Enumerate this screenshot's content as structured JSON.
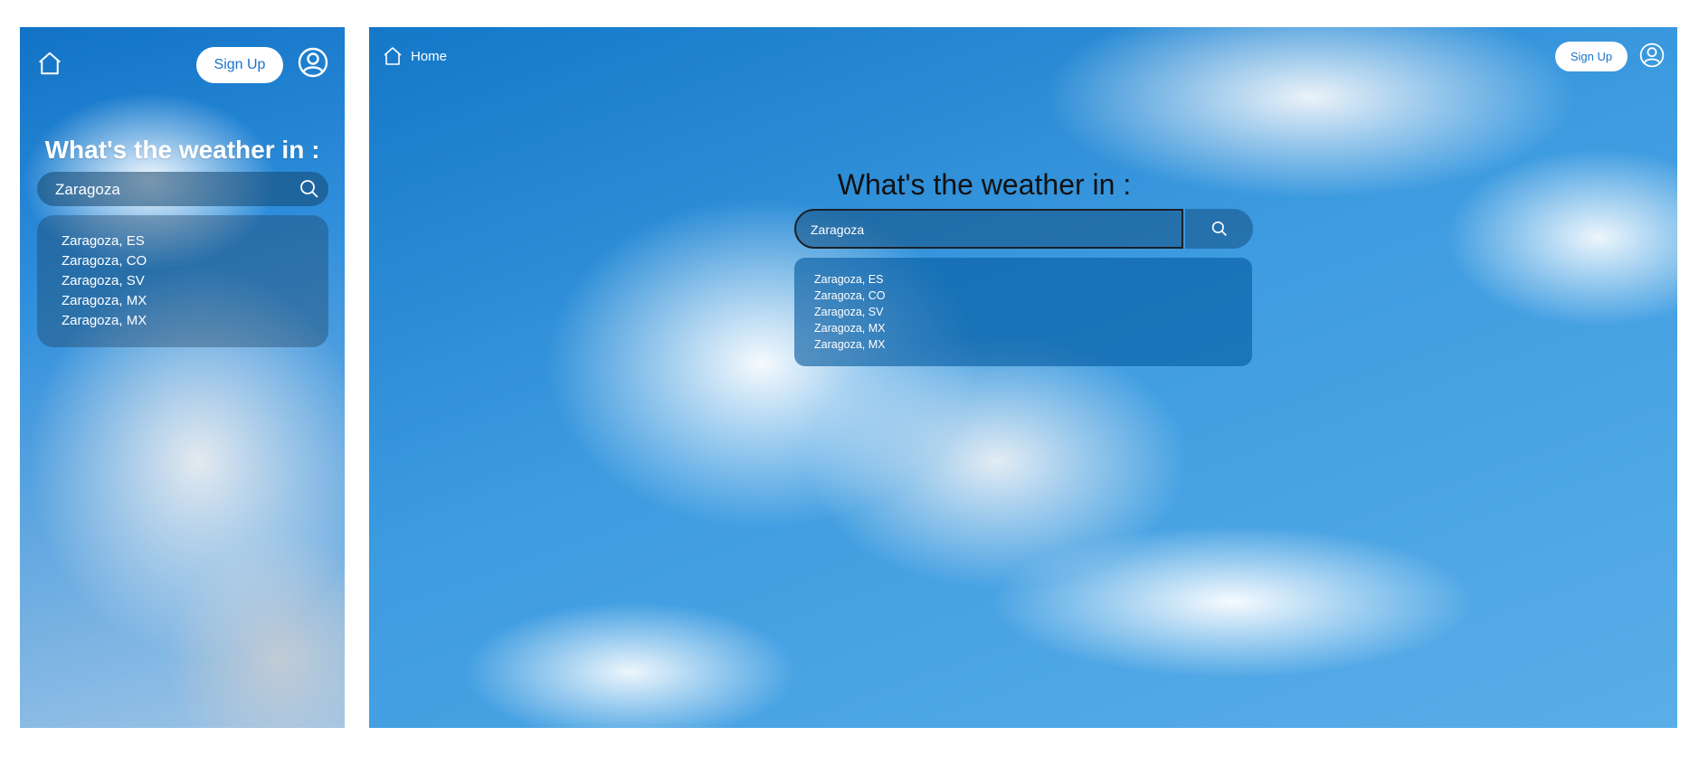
{
  "colors": {
    "sky_blue": "#1478c8",
    "button_bg": "#ffffff",
    "button_text": "#1a73c8",
    "heading_mobile": "#ffffff",
    "heading_desktop": "#111111"
  },
  "icons": {
    "home": "home-icon",
    "user": "user-circle-icon",
    "search": "search-icon"
  },
  "mobile": {
    "signup_label": "Sign Up",
    "heading": "What's the weather in :",
    "search": {
      "value": "Zaragoza"
    },
    "suggestions": [
      "Zaragoza, ES",
      "Zaragoza, CO",
      "Zaragoza, SV",
      "Zaragoza, MX",
      "Zaragoza, MX"
    ]
  },
  "desktop": {
    "home_label": "Home",
    "signup_label": "Sign Up",
    "heading": "What's the weather in :",
    "search": {
      "value": "Zaragoza"
    },
    "suggestions": [
      "Zaragoza, ES",
      "Zaragoza, CO",
      "Zaragoza, SV",
      "Zaragoza, MX",
      "Zaragoza, MX"
    ]
  }
}
